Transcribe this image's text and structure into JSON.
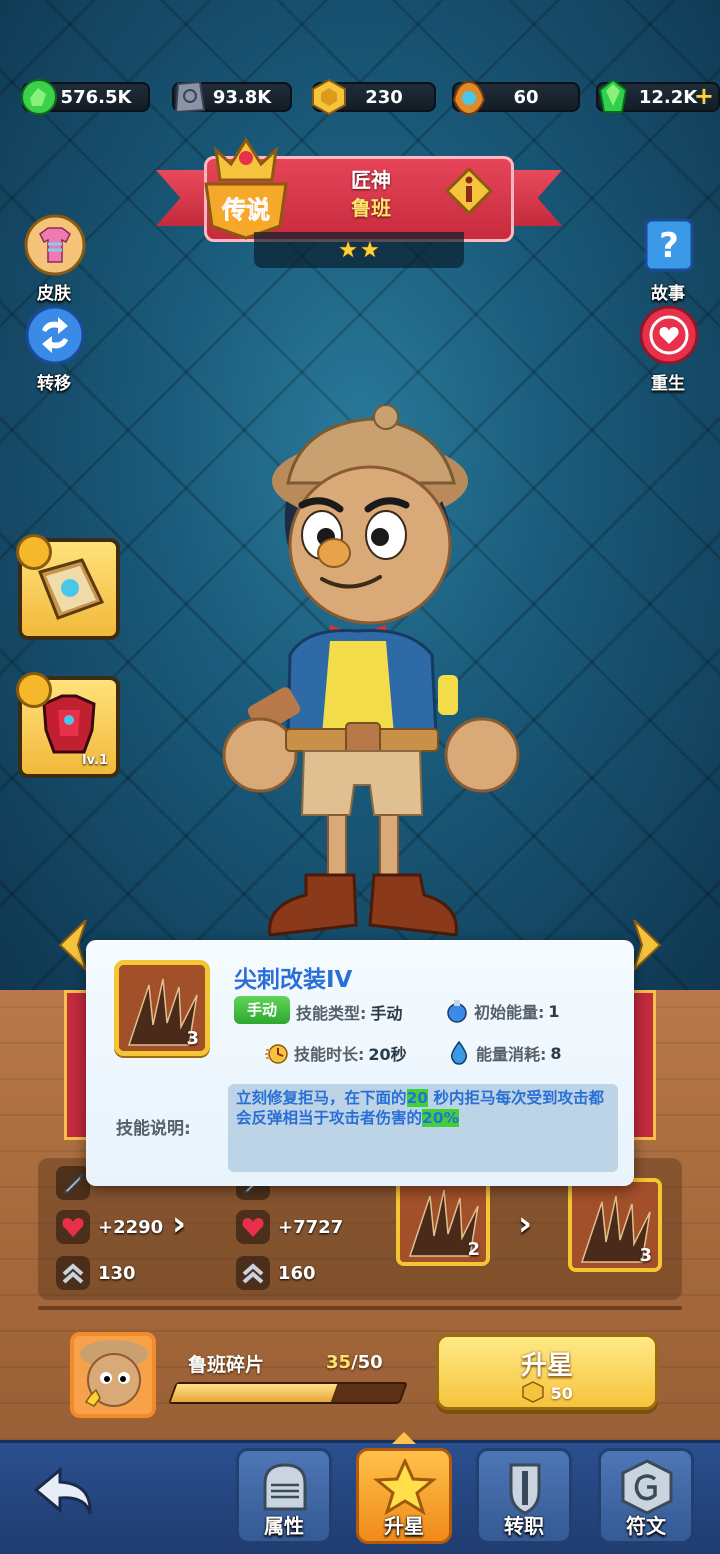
{
  "currencies": [
    {
      "icon": "green-gem-cluster-icon",
      "value": "576.5K"
    },
    {
      "icon": "stone-tablet-icon",
      "value": "93.8K"
    },
    {
      "icon": "gold-hexagon-coin-icon",
      "value": "230"
    },
    {
      "icon": "bronze-emblem-icon",
      "value": "60"
    },
    {
      "icon": "emerald-icon",
      "value": "12.2K",
      "has_add": true
    }
  ],
  "hero": {
    "rarity": "传说",
    "title": "匠神",
    "name": "鲁班",
    "stars": 2
  },
  "side_left": [
    {
      "label": "皮肤",
      "icon": "shirt-icon"
    },
    {
      "label": "转移",
      "icon": "swap-arrows-icon"
    }
  ],
  "side_right": [
    {
      "label": "故事",
      "icon": "question-book-icon"
    },
    {
      "label": "重生",
      "icon": "heart-rebirth-icon"
    }
  ],
  "equipment": [
    {
      "icon": "spellbook-icon",
      "level": ""
    },
    {
      "icon": "armor-icon",
      "level": "lv.1"
    }
  ],
  "stats": {
    "left": {
      "hp": "+2290",
      "speed": "130"
    },
    "right": {
      "hp": "+7727",
      "speed": "160"
    }
  },
  "skill_upgrade": {
    "from_level": "2",
    "to_level": "3"
  },
  "popup": {
    "skill_name": "尖刺改装IV",
    "skill_level": "3",
    "tag": "手动",
    "type_label": "技能类型:",
    "type_value": "手动",
    "start_energy_label": "初始能量:",
    "start_energy_value": "1",
    "duration_label": "技能时长:",
    "duration_value": "20秒",
    "energy_cost_label": "能量消耗:",
    "energy_cost_value": "8",
    "desc_label": "技能说明:",
    "desc_part1": "立刻修复拒马，在下面的",
    "desc_hl1": "20",
    "desc_part2": " 秒内拒马每次受到攻击都会反弹相当于攻击者伤害的",
    "desc_hl2": "20%"
  },
  "shards": {
    "label": "鲁班碎片",
    "current": "35",
    "separator": "/",
    "required": "50",
    "progress": 0.7
  },
  "upstar_button": {
    "label": "升星",
    "cost": "50"
  },
  "nav": [
    {
      "label": "属性",
      "icon": "knight-helmet-icon",
      "active": false
    },
    {
      "label": "升星",
      "icon": "star-icon",
      "active": true
    },
    {
      "label": "转职",
      "icon": "sword-shield-icon",
      "active": false
    },
    {
      "label": "符文",
      "icon": "rune-stone-icon",
      "active": false
    }
  ],
  "colors": {
    "accent_gold": "#f5c43c",
    "banner_red": "#d63547",
    "popup_title": "#2a6fd6",
    "highlight_green": "#3fd13a"
  }
}
